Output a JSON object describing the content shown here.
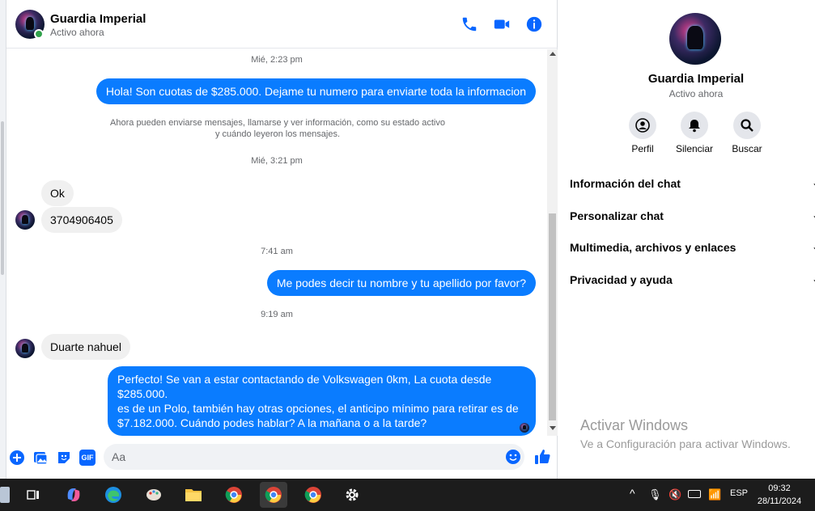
{
  "contact": {
    "name": "Guardia Imperial",
    "status": "Activo ahora"
  },
  "messages": {
    "ts1": "Mié, 2:23 pm",
    "out1": "Hola! Son cuotas de $285.000. Dejame tu numero para enviarte toda la informacion",
    "system_line1": "Ahora pueden enviarse mensajes, llamarse y ver información, como su estado activo",
    "system_line2": "y cuándo leyeron los mensajes.",
    "ts2": "Mié, 3:21 pm",
    "in1": "Ok",
    "in2": "3704906405",
    "ts3": "7:41 am",
    "out2": "Me podes decir tu nombre y tu apellido por favor?",
    "ts4": "9:19 am",
    "in3": "Duarte nahuel",
    "out3_line1": "Perfecto!  Se van a estar contactando de Volkswagen 0km, La cuota desde $285.000.",
    "out3_line2": "es de un Polo, también hay otras opciones, el anticipo mínimo para retirar es de",
    "out3_line3": "$7.182.000. Cuándo podes hablar? A la mañana o a la tarde?"
  },
  "composer": {
    "placeholder": "Aa",
    "gif_label": "GIF"
  },
  "info_panel": {
    "actions": [
      "Perfil",
      "Silenciar",
      "Buscar"
    ],
    "sections": [
      "Información del chat",
      "Personalizar chat",
      "Multimedia, archivos y enlaces",
      "Privacidad y ayuda"
    ]
  },
  "watermark": {
    "title": "Activar Windows",
    "subtitle": "Ve a Configuración para activar Windows."
  },
  "taskbar": {
    "language": "ESP",
    "time": "09:32",
    "date": "28/11/2024"
  },
  "colors": {
    "accent": "#0a7cff",
    "icon_blue": "#0866ff",
    "online": "#31a24c"
  },
  "icons": [
    "phone-icon",
    "video-icon",
    "info-icon",
    "plus-icon",
    "image-icon",
    "sticker-icon",
    "gif-icon",
    "emoji-icon",
    "like-icon",
    "profile-icon",
    "bell-icon",
    "search-icon",
    "chevron-down-icon"
  ]
}
